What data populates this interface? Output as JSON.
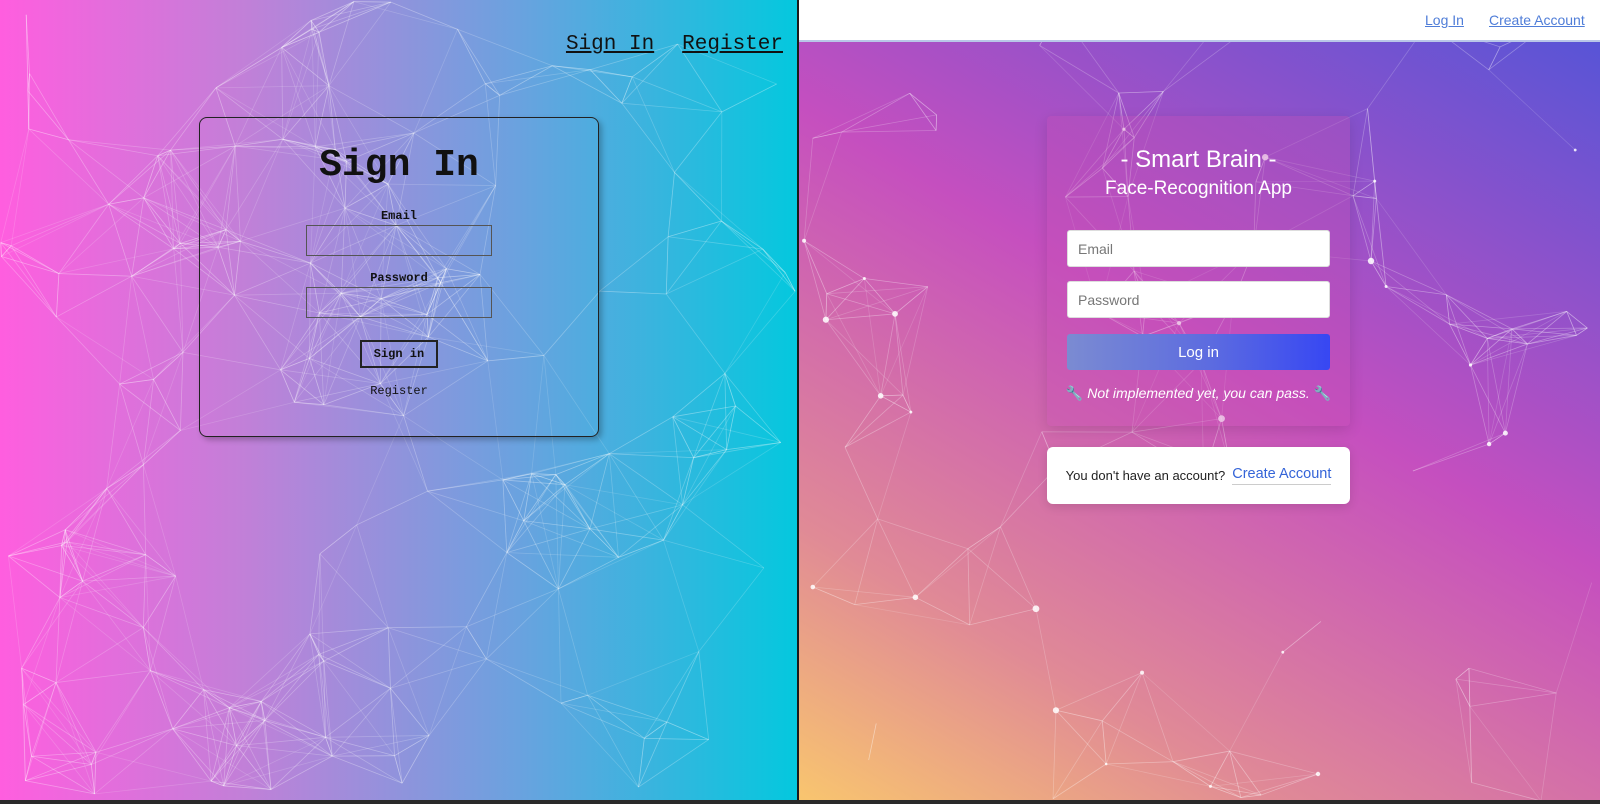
{
  "left_panel": {
    "nav": {
      "sign_in": "Sign In",
      "register": "Register"
    },
    "card": {
      "title": "Sign In",
      "email_label": "Email",
      "email_value": "",
      "password_label": "Password",
      "password_value": "",
      "sign_in_button": "Sign in",
      "register_link": "Register"
    }
  },
  "right_panel": {
    "nav": {
      "log_in": "Log In",
      "create_account": "Create Account"
    },
    "card": {
      "title": "- Smart Brain -",
      "subtitle": "Face-Recognition App",
      "email_placeholder": "Email",
      "password_placeholder": "Password",
      "login_button": "Log in",
      "note": "Not implemented yet, you can pass.",
      "note_icon": "wrench-icon"
    },
    "account": {
      "text": "You don't have an account?",
      "link": "Create Account"
    }
  },
  "colors": {
    "left_gradient": [
      "#ff5edf",
      "#04c8de"
    ],
    "right_gradient": [
      "#f9c66e",
      "#c54fbf",
      "#4f55d8"
    ],
    "link_blue": "#4f7dd8",
    "button_blue": "#3747f3"
  }
}
